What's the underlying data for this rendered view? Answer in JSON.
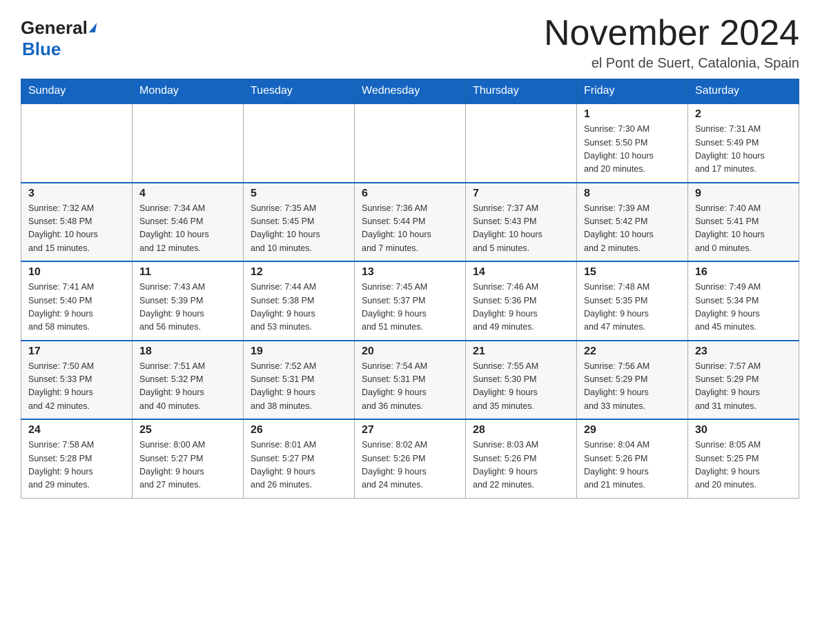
{
  "logo": {
    "general": "General",
    "blue": "Blue"
  },
  "title": "November 2024",
  "location": "el Pont de Suert, Catalonia, Spain",
  "weekdays": [
    "Sunday",
    "Monday",
    "Tuesday",
    "Wednesday",
    "Thursday",
    "Friday",
    "Saturday"
  ],
  "weeks": [
    [
      {
        "day": "",
        "info": ""
      },
      {
        "day": "",
        "info": ""
      },
      {
        "day": "",
        "info": ""
      },
      {
        "day": "",
        "info": ""
      },
      {
        "day": "",
        "info": ""
      },
      {
        "day": "1",
        "info": "Sunrise: 7:30 AM\nSunset: 5:50 PM\nDaylight: 10 hours\nand 20 minutes."
      },
      {
        "day": "2",
        "info": "Sunrise: 7:31 AM\nSunset: 5:49 PM\nDaylight: 10 hours\nand 17 minutes."
      }
    ],
    [
      {
        "day": "3",
        "info": "Sunrise: 7:32 AM\nSunset: 5:48 PM\nDaylight: 10 hours\nand 15 minutes."
      },
      {
        "day": "4",
        "info": "Sunrise: 7:34 AM\nSunset: 5:46 PM\nDaylight: 10 hours\nand 12 minutes."
      },
      {
        "day": "5",
        "info": "Sunrise: 7:35 AM\nSunset: 5:45 PM\nDaylight: 10 hours\nand 10 minutes."
      },
      {
        "day": "6",
        "info": "Sunrise: 7:36 AM\nSunset: 5:44 PM\nDaylight: 10 hours\nand 7 minutes."
      },
      {
        "day": "7",
        "info": "Sunrise: 7:37 AM\nSunset: 5:43 PM\nDaylight: 10 hours\nand 5 minutes."
      },
      {
        "day": "8",
        "info": "Sunrise: 7:39 AM\nSunset: 5:42 PM\nDaylight: 10 hours\nand 2 minutes."
      },
      {
        "day": "9",
        "info": "Sunrise: 7:40 AM\nSunset: 5:41 PM\nDaylight: 10 hours\nand 0 minutes."
      }
    ],
    [
      {
        "day": "10",
        "info": "Sunrise: 7:41 AM\nSunset: 5:40 PM\nDaylight: 9 hours\nand 58 minutes."
      },
      {
        "day": "11",
        "info": "Sunrise: 7:43 AM\nSunset: 5:39 PM\nDaylight: 9 hours\nand 56 minutes."
      },
      {
        "day": "12",
        "info": "Sunrise: 7:44 AM\nSunset: 5:38 PM\nDaylight: 9 hours\nand 53 minutes."
      },
      {
        "day": "13",
        "info": "Sunrise: 7:45 AM\nSunset: 5:37 PM\nDaylight: 9 hours\nand 51 minutes."
      },
      {
        "day": "14",
        "info": "Sunrise: 7:46 AM\nSunset: 5:36 PM\nDaylight: 9 hours\nand 49 minutes."
      },
      {
        "day": "15",
        "info": "Sunrise: 7:48 AM\nSunset: 5:35 PM\nDaylight: 9 hours\nand 47 minutes."
      },
      {
        "day": "16",
        "info": "Sunrise: 7:49 AM\nSunset: 5:34 PM\nDaylight: 9 hours\nand 45 minutes."
      }
    ],
    [
      {
        "day": "17",
        "info": "Sunrise: 7:50 AM\nSunset: 5:33 PM\nDaylight: 9 hours\nand 42 minutes."
      },
      {
        "day": "18",
        "info": "Sunrise: 7:51 AM\nSunset: 5:32 PM\nDaylight: 9 hours\nand 40 minutes."
      },
      {
        "day": "19",
        "info": "Sunrise: 7:52 AM\nSunset: 5:31 PM\nDaylight: 9 hours\nand 38 minutes."
      },
      {
        "day": "20",
        "info": "Sunrise: 7:54 AM\nSunset: 5:31 PM\nDaylight: 9 hours\nand 36 minutes."
      },
      {
        "day": "21",
        "info": "Sunrise: 7:55 AM\nSunset: 5:30 PM\nDaylight: 9 hours\nand 35 minutes."
      },
      {
        "day": "22",
        "info": "Sunrise: 7:56 AM\nSunset: 5:29 PM\nDaylight: 9 hours\nand 33 minutes."
      },
      {
        "day": "23",
        "info": "Sunrise: 7:57 AM\nSunset: 5:29 PM\nDaylight: 9 hours\nand 31 minutes."
      }
    ],
    [
      {
        "day": "24",
        "info": "Sunrise: 7:58 AM\nSunset: 5:28 PM\nDaylight: 9 hours\nand 29 minutes."
      },
      {
        "day": "25",
        "info": "Sunrise: 8:00 AM\nSunset: 5:27 PM\nDaylight: 9 hours\nand 27 minutes."
      },
      {
        "day": "26",
        "info": "Sunrise: 8:01 AM\nSunset: 5:27 PM\nDaylight: 9 hours\nand 26 minutes."
      },
      {
        "day": "27",
        "info": "Sunrise: 8:02 AM\nSunset: 5:26 PM\nDaylight: 9 hours\nand 24 minutes."
      },
      {
        "day": "28",
        "info": "Sunrise: 8:03 AM\nSunset: 5:26 PM\nDaylight: 9 hours\nand 22 minutes."
      },
      {
        "day": "29",
        "info": "Sunrise: 8:04 AM\nSunset: 5:26 PM\nDaylight: 9 hours\nand 21 minutes."
      },
      {
        "day": "30",
        "info": "Sunrise: 8:05 AM\nSunset: 5:25 PM\nDaylight: 9 hours\nand 20 minutes."
      }
    ]
  ]
}
